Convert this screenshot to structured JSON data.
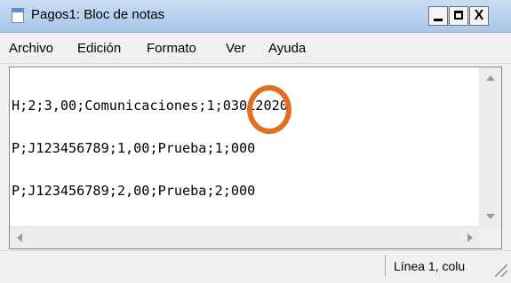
{
  "window": {
    "title": "Pagos1: Bloc de notas",
    "buttons": {
      "minimize": "minimize",
      "maximize": "maximize",
      "close": "X"
    }
  },
  "menu": {
    "items": [
      "Archivo",
      "Edición",
      "Formato",
      "Ver",
      "Ayuda"
    ]
  },
  "editor": {
    "lines": [
      "H;2;3,00;Comunicaciones;1;03012020",
      "P;J123456789;1,00;Prueba;1;000",
      "P;J123456789;2,00;Prueba;2;000"
    ]
  },
  "status": {
    "position": "Línea 1, colu"
  },
  "annotation": {
    "color": "#e0701f",
    "shape": "circle"
  },
  "icons": {
    "app": "notepad-icon",
    "scroll": [
      "scroll-up-icon",
      "scroll-down-icon",
      "scroll-left-icon",
      "scroll-right-icon"
    ],
    "resize": "resize-grip-icon"
  }
}
